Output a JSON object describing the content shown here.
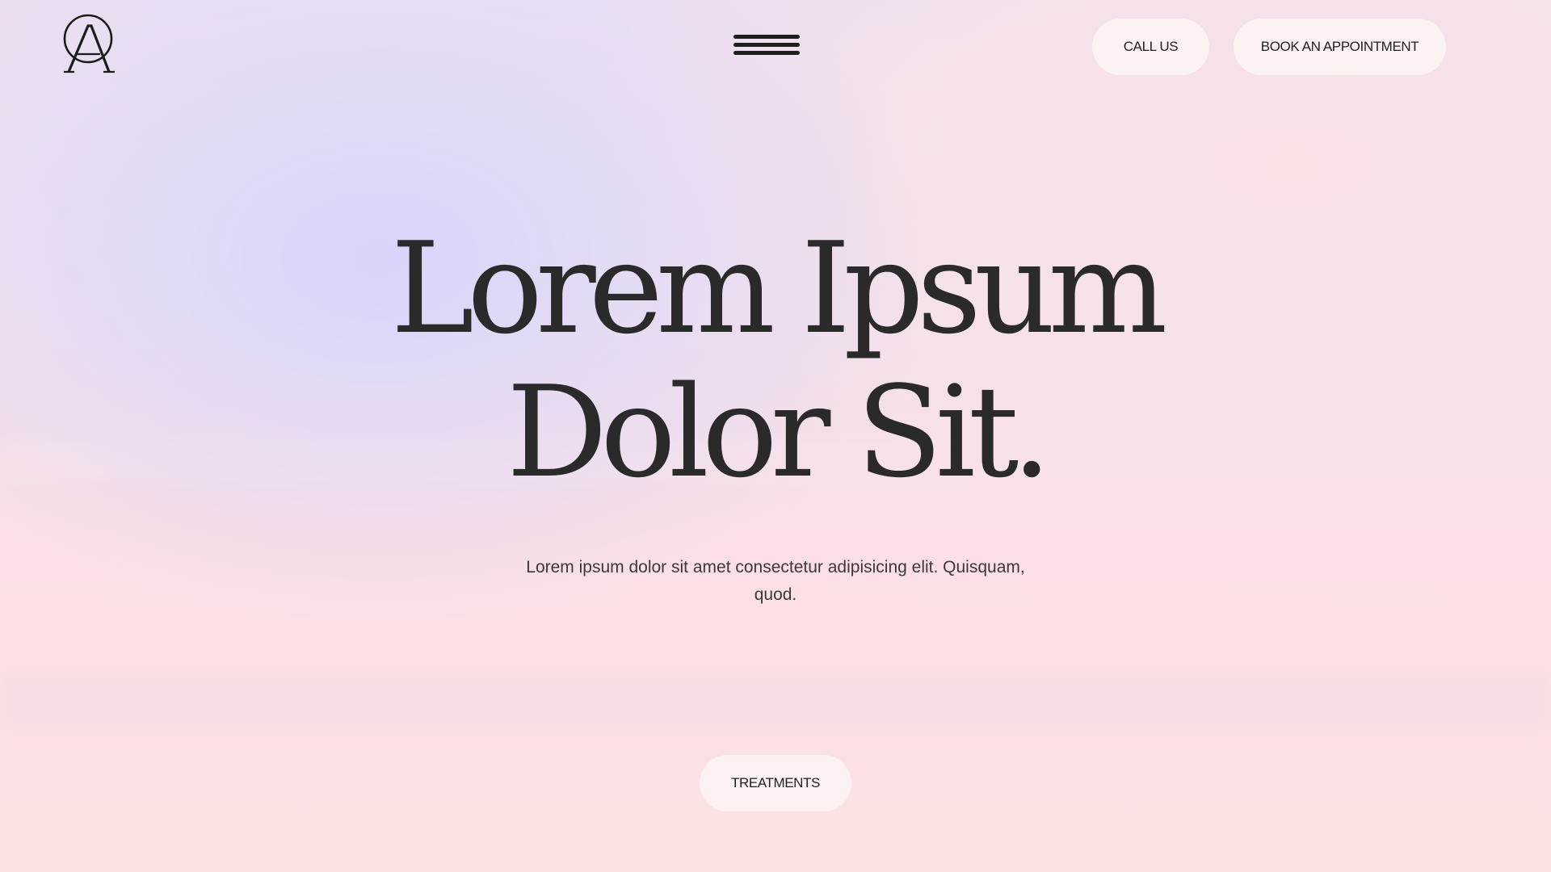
{
  "header": {
    "logo_icon": "monogram-a-circle-logo",
    "menu_icon": "hamburger-menu-icon",
    "call_label": "CALL US",
    "book_label": "BOOK AN APPOINTMENT"
  },
  "hero": {
    "title_line1": "Lorem Ipsum",
    "title_line2": "Dolor Sit.",
    "subtitle": "Lorem ipsum dolor sit amet consectetur adipisicing elit. Quisquam, quod.",
    "cta_label": "TREATMENTS"
  },
  "colors": {
    "text": "#262626",
    "button_bg": "#fdf2f2",
    "bg_lavender": "#ddd8f9",
    "bg_pink": "#fde2e4"
  }
}
